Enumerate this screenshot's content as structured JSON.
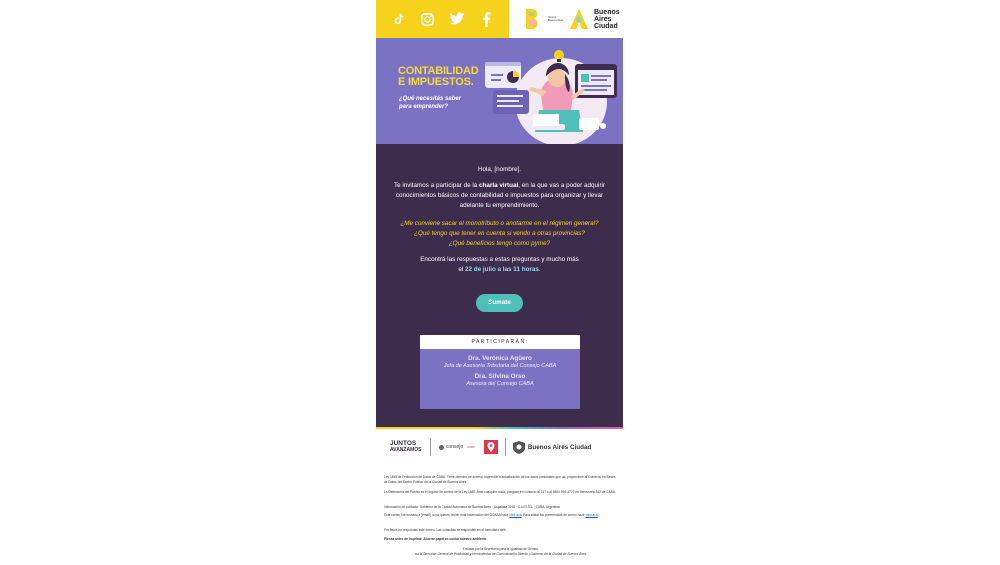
{
  "colors": {
    "yellow": "#f7d21c",
    "lavender": "#7b72c4",
    "dark_purple": "#3e2c4c",
    "teal": "#4fbfb9"
  },
  "header": {
    "social_icons": [
      "tiktok-icon",
      "instagram-icon",
      "twitter-icon",
      "facebook-icon"
    ],
    "brand_name": "Buenos Aires Ciudad",
    "brand_small": "Vamos Buenos Aires"
  },
  "hero": {
    "title_line1": "CONTABILIDAD",
    "title_line2": "E IMPUESTOS.",
    "subtitle_line1": "¿Qué necesitás saber",
    "subtitle_line2": "para emprender?"
  },
  "body": {
    "greeting": "Hola, [nombre].",
    "invite_pre": "Te invitamos a participar de la ",
    "invite_bold": "charla virtual",
    "invite_post": ", en la que vas a poder adquirir conocimientos básicos de contabilidad e impuestos para organizar y llevar adelante tu emprendimiento.",
    "questions": [
      "¿Me conviene sacar el monotributo o anotarme en el régimen general?",
      "¿Qué tengo que tener en cuenta si vendo a otras provincias?",
      "¿Qué beneficios tengo como pyme?"
    ],
    "answers_line1": "Encontrá las respuestas a estas preguntas y mucho más",
    "answers_pre": "el ",
    "answers_date": "22 de julio a las 11 horas",
    "answers_post": ".",
    "cta": "Sumate"
  },
  "speakers": {
    "heading": "PARTICIPARÁN:",
    "items": [
      {
        "name": "Dra. Verónica Agüero",
        "role": "Jefa de Asesoría Tributaria del Consejo CABA"
      },
      {
        "name": "Dra. Silvina Orso",
        "role": "Asesora del Consejo CABA"
      }
    ]
  },
  "partners": {
    "juntos_1": "JUNTOS",
    "juntos_2": "AVANZAMOS",
    "consejo": "consejo",
    "consejo_sub": "CABA",
    "ba": "Buenos Aires Ciudad"
  },
  "legal": {
    "p1": "Ley 1845 de Protección de Datos de CABA: Tiene derecho de acceso, supresión o actualización de los datos personales que ud. proporcione al Gobierno en Bases de Datos del Sector Público de la Ciudad de Buenos Aires.",
    "p2": "La Defensoría del Pueblo es el órgano de control de la Ley 1845. Ante cualquier duda, póngase en contacto al 147 o al 0800-999-3727 en Venezuela 842 de CABA.",
    "p3": "Información de contacto: Gobierno de la Ciudad Autónoma de Buenos Aires · Uspallata 3160 · C1437JCL · CABA, Argentina.",
    "p4_pre": "Este correo fue enviado a [email], si no querés recibir más información del GCABA hacé ",
    "p4_link1": "click acá",
    "p4_mid": ". Para editar tus preferencias de correo hacé ",
    "p4_link2": "click acá",
    "p4_post": ".",
    "p5": "Por favor, no respondas este correo. Las consultas se responden en el formulario web.",
    "p6": "Piensa antes de imprimir. Ahorrar papel es cuidar nuestro ambiente.",
    "p7": "Enviado por la Secretaría para la Igualdad de Género",
    "p8": "vía la Dirección General de Publicidad y Herramientas de Comunicación Directa | Gobierno de la Ciudad de Buenos Aires"
  }
}
